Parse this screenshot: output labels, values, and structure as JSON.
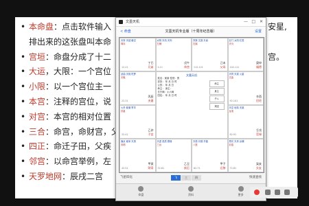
{
  "slide": {
    "bullets": [
      {
        "term": "本命盘",
        "text": "：点击软件输入",
        "tail": "安星,"
      },
      {
        "term": "",
        "text": "排出来的这张盘叫本命",
        "tail": ""
      },
      {
        "term": "宫垣",
        "text": "：命盘分成了十二",
        "tail": "宫。"
      },
      {
        "term": "大运",
        "text": "，大限：一个宫位",
        "tail": ""
      },
      {
        "term": "小限",
        "text": "：以一个宫位主一",
        "tail": ""
      },
      {
        "term": "本宫",
        "text": "：注释的宫位，说",
        "tail": ""
      },
      {
        "term": "对宫",
        "text": "：本宫的相对位置",
        "tail": ""
      },
      {
        "term": "三合",
        "text": "：命宫，命财宫，父子",
        "tail": ""
      },
      {
        "term": "四正",
        "text": "：命迁子田，父疾",
        "tail": ""
      },
      {
        "term": "邻宫",
        "text": "：以命宫举例，左",
        "tail": ""
      },
      {
        "term": "天罗地网",
        "text": "：辰戌二宫",
        "tail": ""
      }
    ]
  },
  "window": {
    "app_name": "文墨天机",
    "title": "文墨天机专业版（十周年纪念版）",
    "back": "< 命盘",
    "settings": "设置",
    "cells": [
      {
        "stars": "天府 天钺 截空",
        "minor": "禄存",
        "stem": "丁巳",
        "name": "兄弟",
        "range": "12-21"
      },
      {
        "stars": "太阴 天机 天刑",
        "minor": "左辅",
        "stem": "戊午",
        "name": "命宫",
        "range": "2-11"
      },
      {
        "stars": "贪狼 文昌 天喜",
        "minor": "右弼",
        "stem": "己未",
        "name": "父母",
        "range": "112-121"
      },
      {
        "stars": "巨门 太阳 红鸾",
        "minor": "天马",
        "stem": "庚申",
        "name": "福德",
        "range": "102-111"
      },
      {
        "stars": "武曲 天相 陀罗",
        "minor": "天魁",
        "stem": "丙辰",
        "name": "夫妻",
        "range": "22-31"
      },
      {
        "stars": "天同 天梁 火星",
        "minor": "文曲",
        "stem": "辛酉",
        "name": "田宅",
        "range": "92-101"
      },
      {
        "stars": "七杀 紫微 擎羊",
        "minor": "铃星",
        "stem": "乙卯",
        "name": "子女",
        "range": "32-41"
      },
      {
        "stars": "天空 地劫 天姚",
        "minor": "龙池",
        "stem": "壬戌",
        "name": "官禄",
        "range": "82-91"
      },
      {
        "stars": "廉贞 破军 天哭",
        "minor": "凤阁",
        "stem": "甲寅",
        "name": "财帛",
        "range": "42-51"
      },
      {
        "stars": "天虚 孤辰 寡宿",
        "minor": "三台",
        "stem": "乙丑",
        "name": "疾厄",
        "range": "52-61"
      },
      {
        "stars": "天德 月德 华盖",
        "minor": "八座",
        "stem": "甲子",
        "name": "迁移",
        "range": "62-71"
      },
      {
        "stars": "恩光 天贵 台辅",
        "minor": "封诰",
        "stem": "癸亥",
        "name": "交友",
        "range": "72-81"
      }
    ],
    "center": {
      "title": "文墨天机",
      "lines": [
        "姓名：某某  性别：男",
        "农历：  年  月  日  时",
        "公历：  年  月  日",
        "命主：  身主：",
        "五行局：火六局",
        "四柱：  年  月  日  时"
      ],
      "boxes": [
        "命主",
        "身主",
        "子斗",
        "来因"
      ]
    },
    "bottombar": {
      "left": "飞星四化",
      "seg": [
        "飞",
        "三",
        "四"
      ],
      "right": "快速查找"
    },
    "tabs": [
      "命盘",
      "资料",
      "更多"
    ]
  }
}
